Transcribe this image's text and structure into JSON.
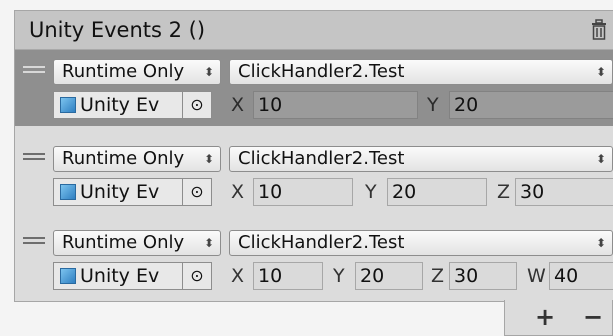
{
  "component": {
    "title": "Unity Events 2 ()"
  },
  "events": [
    {
      "mode": "Runtime Only",
      "function": "ClickHandler2.Test",
      "object": "Unity Ev",
      "params": [
        {
          "label": "X",
          "value": "10"
        },
        {
          "label": "Y",
          "value": "20"
        }
      ]
    },
    {
      "mode": "Runtime Only",
      "function": "ClickHandler2.Test",
      "object": "Unity Ev",
      "params": [
        {
          "label": "X",
          "value": "10"
        },
        {
          "label": "Y",
          "value": "20"
        },
        {
          "label": "Z",
          "value": "30"
        }
      ]
    },
    {
      "mode": "Runtime Only",
      "function": "ClickHandler2.Test",
      "object": "Unity Ev",
      "params": [
        {
          "label": "X",
          "value": "10"
        },
        {
          "label": "Y",
          "value": "20"
        },
        {
          "label": "Z",
          "value": "30"
        },
        {
          "label": "W",
          "value": "40"
        }
      ]
    }
  ],
  "footer": {
    "add_label": "+",
    "remove_label": "−"
  },
  "icons": {
    "delete": "trash-icon",
    "drag": "drag-handle-icon",
    "object": "unity-object-icon",
    "picker": "object-picker-icon",
    "dropdown": "dropdown-arrow-icon"
  }
}
